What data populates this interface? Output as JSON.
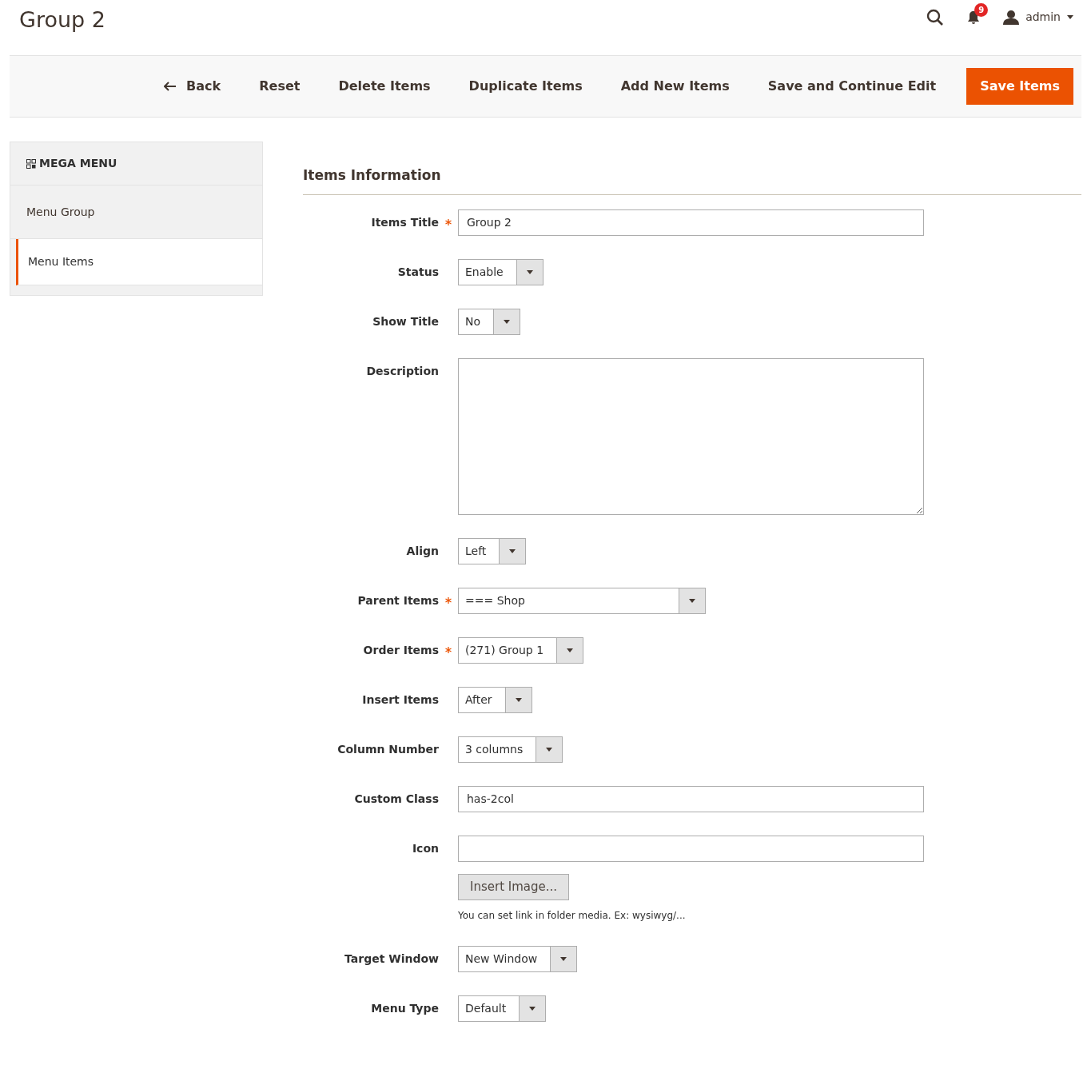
{
  "page_title": "Group 2",
  "header": {
    "notifications_count": "9",
    "user": "admin"
  },
  "actions": [
    {
      "label": "Back",
      "kind": "back"
    },
    {
      "label": "Reset",
      "kind": "plain"
    },
    {
      "label": "Delete Items",
      "kind": "plain"
    },
    {
      "label": "Duplicate Items",
      "kind": "plain"
    },
    {
      "label": "Add New Items",
      "kind": "plain"
    },
    {
      "label": "Save and Continue Edit",
      "kind": "plain"
    },
    {
      "label": "Save Items",
      "kind": "primary"
    }
  ],
  "sidebar": {
    "title": "MEGA MENU",
    "items": [
      {
        "label": "Menu Group",
        "selected": false
      },
      {
        "label": "Menu Items",
        "selected": true
      }
    ]
  },
  "section_title": "Items Information",
  "fields": [
    {
      "label": "Items Title",
      "required": true,
      "kind": "text",
      "value": "Group 2"
    },
    {
      "label": "Status",
      "required": false,
      "kind": "select",
      "value": "Enable"
    },
    {
      "label": "Show Title",
      "required": false,
      "kind": "select",
      "value": "No"
    },
    {
      "label": "Description",
      "required": false,
      "kind": "textarea"
    },
    {
      "label": "Align",
      "required": false,
      "kind": "select",
      "value": "Left"
    },
    {
      "label": "Parent Items",
      "required": true,
      "kind": "select",
      "value": "=== Shop"
    },
    {
      "label": "Order Items",
      "required": true,
      "kind": "select",
      "value": "(271) Group 1"
    },
    {
      "label": "Insert Items",
      "required": false,
      "kind": "select",
      "value": "After"
    },
    {
      "label": "Column Number",
      "required": false,
      "kind": "select",
      "value": "3 columns"
    },
    {
      "label": "Custom Class",
      "required": false,
      "kind": "text",
      "value": "has-2col"
    },
    {
      "label": "Icon",
      "required": false,
      "kind": "image",
      "button": "Insert Image...",
      "note": "You can set link in folder media. Ex: wysiwyg/..."
    },
    {
      "label": "Target Window",
      "required": false,
      "kind": "select",
      "value": "New Window"
    },
    {
      "label": "Menu Type",
      "required": false,
      "kind": "select",
      "value": "Default"
    }
  ]
}
